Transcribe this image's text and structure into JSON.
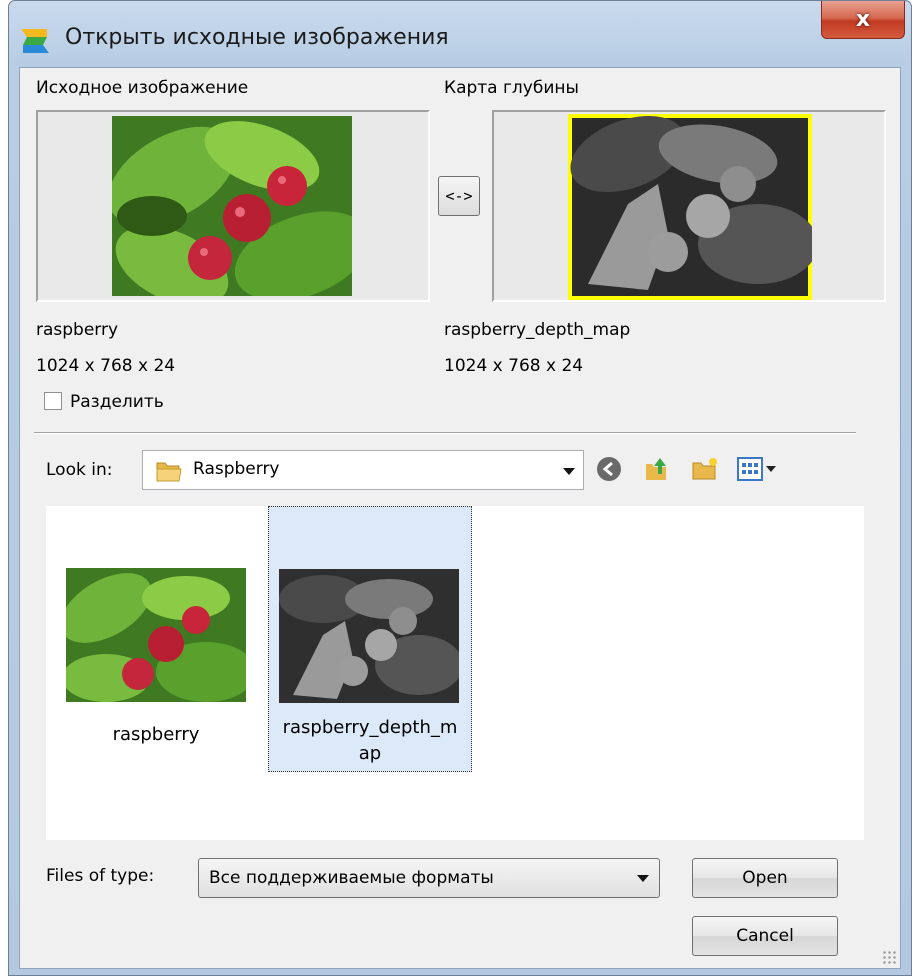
{
  "window": {
    "title": "Открыть исходные изображения",
    "close_label": "x"
  },
  "source": {
    "heading": "Исходное изображение",
    "name": "raspberry",
    "dims": "1024 x 768 x 24"
  },
  "depth": {
    "heading": "Карта глубины",
    "name": "raspberry_depth_map",
    "dims": "1024 x 768 x 24"
  },
  "swap_label": "<->",
  "split_label": "Разделить",
  "lookin": {
    "label": "Look in:",
    "value": "Raspberry"
  },
  "toolbar": {
    "icons": [
      "back-icon",
      "up-folder-icon",
      "new-folder-icon",
      "view-menu-icon"
    ]
  },
  "files": [
    {
      "name": "raspberry",
      "selected": false
    },
    {
      "name_line1": "raspberry_depth_m",
      "name_line2": "ap",
      "selected": true
    }
  ],
  "filetype": {
    "label": "Files of type:",
    "value": "Все поддерживаемые форматы"
  },
  "buttons": {
    "open": "Open",
    "cancel": "Cancel"
  },
  "colors": {
    "depth_frame": "#ffff00",
    "selection_bg": "#dce9f8",
    "titlebar": "#c9daed",
    "close_button": "#c23b22"
  }
}
